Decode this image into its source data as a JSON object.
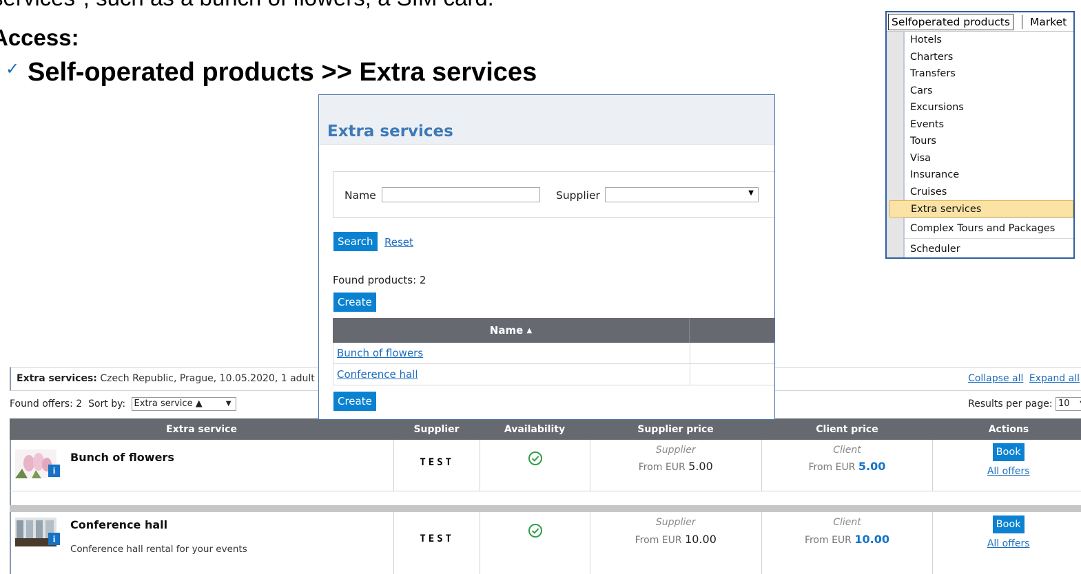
{
  "slide": {
    "intro": "services\", such as a bunch of flowers, a SIM card.",
    "access": "Access:",
    "path": "Self-operated products >> Extra services"
  },
  "menu": {
    "active_tab": "Selfoperated products",
    "other_tab": "Market",
    "items": [
      "Hotels",
      "Charters",
      "Transfers",
      "Cars",
      "Excursions",
      "Events",
      "Tours",
      "Visa",
      "Insurance",
      "Cruises",
      "Extra services"
    ],
    "extra_items": [
      "Complex Tours and Packages",
      "Scheduler"
    ],
    "highlight_color": "#fbe3a6"
  },
  "search_window": {
    "title": "Extra services",
    "name_label": "Name",
    "name_value": "",
    "supplier_label": "Supplier",
    "supplier_value": "",
    "search_button": "Search",
    "reset_link": "Reset",
    "found_products": "Found products: 2",
    "create_button": "Create",
    "table_header": "Name",
    "sort_indicator": "▲",
    "rows": [
      "Bunch of flowers",
      "Conference hall"
    ],
    "create_button_bottom": "Create"
  },
  "results": {
    "summary_label": "Extra services:",
    "summary_text": "Czech Republic, Prague, 10.05.2020, 1 adult",
    "collapse_all": "Collapse all",
    "expand_all": "Expand all",
    "found_offers": "Found offers: 2",
    "sort_by_label": "Sort by:",
    "sort_by_value": "Extra service ▲",
    "per_page_label": "Results per page:",
    "per_page_value": "10",
    "headers": [
      "Extra service",
      "Supplier",
      "Availability",
      "Supplier price",
      "Client price",
      "Actions"
    ],
    "offers": [
      {
        "name": "Bunch of flowers",
        "description": "",
        "supplier": "TEST",
        "supplier_price_label": "Supplier",
        "supplier_price_prefix": "From EUR",
        "supplier_price": "5.00",
        "client_price_label": "Client",
        "client_price_prefix": "From EUR",
        "client_price": "5.00",
        "book": "Book",
        "all_offers": "All offers"
      },
      {
        "name": "Conference hall",
        "description": "Conference hall rental for your events",
        "supplier": "TEST",
        "supplier_price_label": "Supplier",
        "supplier_price_prefix": "From EUR",
        "supplier_price": "10.00",
        "client_price_label": "Client",
        "client_price_prefix": "From EUR",
        "client_price": "10.00",
        "book": "Book",
        "all_offers": "All offers"
      }
    ],
    "accent_color": "#0a82d1",
    "header_color": "#666a70"
  }
}
